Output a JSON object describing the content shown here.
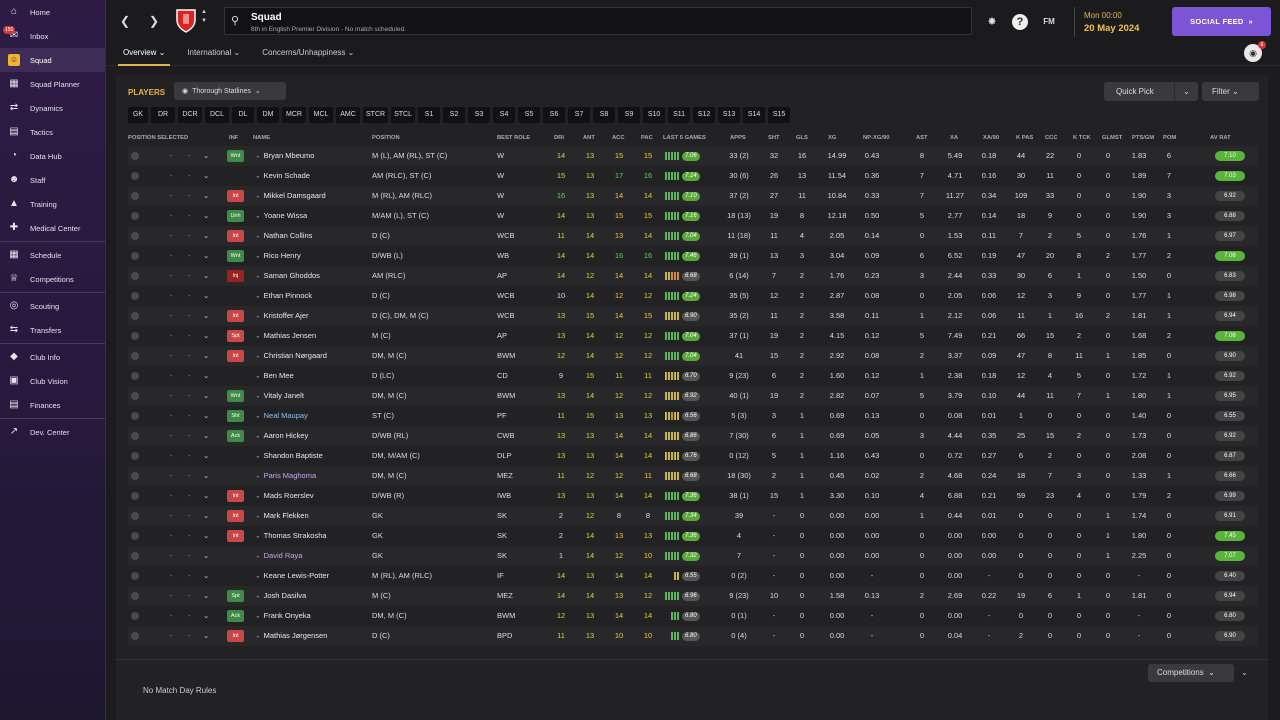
{
  "nav": [
    {
      "label": "Home",
      "icon": "home-icon",
      "glyph": "⌂"
    },
    {
      "label": "Inbox",
      "icon": "inbox-icon",
      "glyph": "✉",
      "badge": "150"
    },
    {
      "label": "Squad",
      "icon": "squad-icon",
      "glyph": "☺",
      "selected": true
    },
    {
      "label": "Squad Planner",
      "icon": "squad-planner-icon",
      "glyph": "▦"
    },
    {
      "label": "Dynamics",
      "icon": "dynamics-icon",
      "glyph": "⇄"
    },
    {
      "label": "Tactics",
      "icon": "tactics-icon",
      "glyph": "▤"
    },
    {
      "label": "Data Hub",
      "icon": "data-hub-icon",
      "glyph": "◔"
    },
    {
      "label": "Staff",
      "icon": "staff-icon",
      "glyph": "☻"
    },
    {
      "label": "Training",
      "icon": "training-icon",
      "glyph": "▲"
    },
    {
      "label": "Medical Center",
      "icon": "medical-center-icon",
      "glyph": "✚"
    },
    {
      "label": "Schedule",
      "icon": "schedule-icon",
      "glyph": "▦",
      "sep": true
    },
    {
      "label": "Competitions",
      "icon": "competitions-icon",
      "glyph": "♕"
    },
    {
      "label": "Scouting",
      "icon": "scouting-icon",
      "glyph": "◎",
      "sep": true
    },
    {
      "label": "Transfers",
      "icon": "transfers-icon",
      "glyph": "⇆"
    },
    {
      "label": "Club Info",
      "icon": "club-info-icon",
      "glyph": "◆",
      "sep": true
    },
    {
      "label": "Club Vision",
      "icon": "club-vision-icon",
      "glyph": "▣"
    },
    {
      "label": "Finances",
      "icon": "finances-icon",
      "glyph": "▤"
    },
    {
      "label": "Dev. Center",
      "icon": "dev-center-icon",
      "glyph": "↗",
      "sep": true
    }
  ],
  "header": {
    "title": "Squad",
    "subtitle": "8th in English Premier Division - No match scheduled.",
    "fm": "FM",
    "day": "Mon 00:00",
    "date": "20 May 2024",
    "social": "SOCIAL FEED",
    "avatar_badge": "6"
  },
  "subtabs": [
    "Overview",
    "International",
    "Concerns/Unhappiness"
  ],
  "toolbar": {
    "players": "PLAYERS",
    "view": "Thorough Statlines",
    "quick_pick": "Quick Pick",
    "filter": "Filter"
  },
  "positions": [
    "GK",
    "DR",
    "DCR",
    "DCL",
    "DL",
    "DM",
    "MCR",
    "MCL",
    "AMC",
    "STCR",
    "STCL",
    "S1",
    "S2",
    "S3",
    "S4",
    "S5",
    "S6",
    "S7",
    "S8",
    "S9",
    "S10",
    "S11",
    "S12",
    "S13",
    "S14",
    "S15"
  ],
  "columns": [
    "POSITION SELECTED",
    "INF",
    "NAME",
    "POSITION",
    "BEST ROLE",
    "DRI",
    "ANT",
    "ACC",
    "PAC",
    "LAST 5 GAMES",
    "APPS",
    "SHT",
    "GLS",
    "XG",
    "NP-XG/90",
    "AST",
    "XA",
    "XA/90",
    "K PAS",
    "CCC",
    "K TCK",
    "GLMST",
    "PTS/GM",
    "POM",
    "AV RAT"
  ],
  "players": [
    {
      "inf": "Wnt",
      "infc": "green",
      "name": "Bryan Mbeumo",
      "pos": "M (L), AM (RL), ST (C)",
      "role": "W",
      "dri": "14",
      "ant": "13",
      "acc": "15",
      "pac": "15",
      "form": "ggggg",
      "fr": "7.06",
      "frh": true,
      "apps": "33 (2)",
      "sht": "32",
      "gls": "16",
      "xg": "14.99",
      "npxg": "0.43",
      "ast": "8",
      "xa": "5.49",
      "xa90": "0.18",
      "kpas": "44",
      "ccc": "22",
      "ktck": "0",
      "glmst": "0",
      "ptsgm": "1.83",
      "pom": "6",
      "avrat": "7.10",
      "avh": true,
      "c": [
        "y",
        "y",
        "y",
        "y"
      ]
    },
    {
      "inf": "",
      "infc": "",
      "name": "Kevin Schade",
      "pos": "AM (RLC), ST (C)",
      "role": "W",
      "dri": "15",
      "ant": "13",
      "acc": "17",
      "pac": "16",
      "form": "ggggg",
      "fr": "7.14",
      "frh": true,
      "apps": "30 (6)",
      "sht": "26",
      "gls": "13",
      "xg": "11.54",
      "npxg": "0.36",
      "ast": "7",
      "xa": "4.71",
      "xa90": "0.16",
      "kpas": "30",
      "ccc": "11",
      "ktck": "0",
      "glmst": "0",
      "ptsgm": "1.89",
      "pom": "7",
      "avrat": "7.03",
      "avh": true,
      "c": [
        "y",
        "y",
        "g",
        "g"
      ]
    },
    {
      "inf": "Int",
      "infc": "red",
      "name": "Mikkel Damsgaard",
      "pos": "M (RL), AM (RLC)",
      "role": "W",
      "dri": "16",
      "ant": "13",
      "acc": "14",
      "pac": "14",
      "form": "ggggg",
      "fr": "7.10",
      "frh": true,
      "apps": "37 (2)",
      "sht": "27",
      "gls": "11",
      "xg": "10.84",
      "npxg": "0.33",
      "ast": "7",
      "xa": "11.27",
      "xa90": "0.34",
      "kpas": "109",
      "ccc": "33",
      "ktck": "0",
      "glmst": "0",
      "ptsgm": "1.90",
      "pom": "3",
      "avrat": "6.92",
      "avh": false,
      "c": [
        "g",
        "y",
        "y",
        "y"
      ]
    },
    {
      "inf": "Unh",
      "infc": "green",
      "name": "Yoane Wissa",
      "pos": "M/AM (L), ST (C)",
      "role": "W",
      "dri": "14",
      "ant": "13",
      "acc": "15",
      "pac": "15",
      "form": "ggggg",
      "fr": "7.16",
      "frh": true,
      "apps": "18 (13)",
      "sht": "19",
      "gls": "8",
      "xg": "12.18",
      "npxg": "0.50",
      "ast": "5",
      "xa": "2.77",
      "xa90": "0.14",
      "kpas": "18",
      "ccc": "9",
      "ktck": "0",
      "glmst": "0",
      "ptsgm": "1.90",
      "pom": "3",
      "avrat": "6.88",
      "avh": false,
      "c": [
        "y",
        "y",
        "y",
        "y"
      ]
    },
    {
      "inf": "Int",
      "infc": "red",
      "name": "Nathan Collins",
      "pos": "D (C)",
      "role": "WCB",
      "dri": "11",
      "ant": "14",
      "acc": "13",
      "pac": "14",
      "form": "ggggg",
      "fr": "7.04",
      "frh": true,
      "apps": "11 (18)",
      "sht": "11",
      "gls": "4",
      "xg": "2.05",
      "npxg": "0.14",
      "ast": "0",
      "xa": "1.53",
      "xa90": "0.11",
      "kpas": "7",
      "ccc": "2",
      "ktck": "5",
      "glmst": "0",
      "ptsgm": "1.76",
      "pom": "1",
      "avrat": "6.97",
      "avh": false,
      "c": [
        "y",
        "y",
        "y",
        "y"
      ]
    },
    {
      "inf": "Wnt",
      "infc": "green",
      "name": "Rico Henry",
      "pos": "D/WB (L)",
      "role": "WB",
      "dri": "14",
      "ant": "14",
      "acc": "16",
      "pac": "16",
      "form": "ggggg",
      "fr": "7.46",
      "frh": true,
      "apps": "39 (1)",
      "sht": "13",
      "gls": "3",
      "xg": "3.04",
      "npxg": "0.09",
      "ast": "6",
      "xa": "6.52",
      "xa90": "0.19",
      "kpas": "47",
      "ccc": "20",
      "ktck": "8",
      "glmst": "2",
      "ptsgm": "1.77",
      "pom": "2",
      "avrat": "7.08",
      "avh": true,
      "c": [
        "y",
        "y",
        "g",
        "g"
      ]
    },
    {
      "inf": "Inj",
      "infc": "dred",
      "name": "Saman Ghoddos",
      "pos": "AM (RLC)",
      "role": "AP",
      "dri": "14",
      "ant": "12",
      "acc": "14",
      "pac": "14",
      "form": "yyooo",
      "fr": "6.68",
      "frh": false,
      "apps": "6 (14)",
      "sht": "7",
      "gls": "2",
      "xg": "1.76",
      "npxg": "0.23",
      "ast": "3",
      "xa": "2.44",
      "xa90": "0.33",
      "kpas": "30",
      "ccc": "6",
      "ktck": "1",
      "glmst": "0",
      "ptsgm": "1.50",
      "pom": "0",
      "avrat": "6.83",
      "avh": false,
      "c": [
        "y",
        "y",
        "y",
        "y"
      ]
    },
    {
      "inf": "",
      "infc": "",
      "name": "Ethan Pinnock",
      "pos": "D (C)",
      "role": "WCB",
      "dri": "10",
      "ant": "14",
      "acc": "12",
      "pac": "12",
      "form": "ggggg",
      "fr": "7.24",
      "frh": true,
      "apps": "35 (5)",
      "sht": "12",
      "gls": "2",
      "xg": "2.87",
      "npxg": "0.08",
      "ast": "0",
      "xa": "2.05",
      "xa90": "0.06",
      "kpas": "12",
      "ccc": "3",
      "ktck": "9",
      "glmst": "0",
      "ptsgm": "1.77",
      "pom": "1",
      "avrat": "6.98",
      "avh": false,
      "c": [
        "w",
        "y",
        "y",
        "y"
      ]
    },
    {
      "inf": "Int",
      "infc": "red",
      "name": "Kristoffer Ajer",
      "pos": "D (C), DM, M (C)",
      "role": "WCB",
      "dri": "13",
      "ant": "15",
      "acc": "14",
      "pac": "15",
      "form": "yyyyy",
      "fr": "6.90",
      "frh": false,
      "apps": "35 (2)",
      "sht": "11",
      "gls": "2",
      "xg": "3.58",
      "npxg": "0.11",
      "ast": "1",
      "xa": "2.12",
      "xa90": "0.06",
      "kpas": "11",
      "ccc": "1",
      "ktck": "16",
      "glmst": "2",
      "ptsgm": "1.81",
      "pom": "1",
      "avrat": "6.94",
      "avh": false,
      "c": [
        "y",
        "y",
        "y",
        "y"
      ]
    },
    {
      "inf": "Spt",
      "infc": "red",
      "name": "Mathias Jensen",
      "pos": "M (C)",
      "role": "AP",
      "dri": "13",
      "ant": "14",
      "acc": "12",
      "pac": "12",
      "form": "ggggg",
      "fr": "7.04",
      "frh": true,
      "apps": "37 (1)",
      "sht": "19",
      "gls": "2",
      "xg": "4.15",
      "npxg": "0.12",
      "ast": "5",
      "xa": "7.49",
      "xa90": "0.21",
      "kpas": "66",
      "ccc": "15",
      "ktck": "2",
      "glmst": "0",
      "ptsgm": "1.68",
      "pom": "2",
      "avrat": "7.08",
      "avh": true,
      "c": [
        "y",
        "y",
        "y",
        "y"
      ]
    },
    {
      "inf": "Int",
      "infc": "red",
      "name": "Christian Nørgaard",
      "pos": "DM, M (C)",
      "role": "BWM",
      "dri": "12",
      "ant": "14",
      "acc": "12",
      "pac": "12",
      "form": "ggggg",
      "fr": "7.04",
      "frh": true,
      "apps": "41",
      "sht": "15",
      "gls": "2",
      "xg": "2.92",
      "npxg": "0.08",
      "ast": "2",
      "xa": "3.37",
      "xa90": "0.09",
      "kpas": "47",
      "ccc": "8",
      "ktck": "11",
      "glmst": "1",
      "ptsgm": "1.85",
      "pom": "0",
      "avrat": "6.90",
      "avh": false,
      "c": [
        "y",
        "y",
        "y",
        "y"
      ]
    },
    {
      "inf": "",
      "infc": "",
      "name": "Ben Mee",
      "pos": "D (LC)",
      "role": "CD",
      "dri": "9",
      "ant": "15",
      "acc": "11",
      "pac": "11",
      "form": "yyyyy",
      "fr": "6.70",
      "frh": false,
      "apps": "9 (23)",
      "sht": "6",
      "gls": "2",
      "xg": "1.60",
      "npxg": "0.12",
      "ast": "1",
      "xa": "2.38",
      "xa90": "0.18",
      "kpas": "12",
      "ccc": "4",
      "ktck": "5",
      "glmst": "0",
      "ptsgm": "1.72",
      "pom": "1",
      "avrat": "6.92",
      "avh": false,
      "c": [
        "w",
        "y",
        "y",
        "y"
      ]
    },
    {
      "inf": "Wnt",
      "infc": "green",
      "name": "Vitaly Janelt",
      "pos": "DM, M (C)",
      "role": "BWM",
      "dri": "13",
      "ant": "14",
      "acc": "12",
      "pac": "12",
      "form": "yyyyy",
      "fr": "6.92",
      "frh": false,
      "apps": "40 (1)",
      "sht": "19",
      "gls": "2",
      "xg": "2.82",
      "npxg": "0.07",
      "ast": "5",
      "xa": "3.79",
      "xa90": "0.10",
      "kpas": "44",
      "ccc": "11",
      "ktck": "7",
      "glmst": "1",
      "ptsgm": "1.80",
      "pom": "1",
      "avrat": "6.95",
      "avh": false,
      "c": [
        "y",
        "y",
        "y",
        "y"
      ]
    },
    {
      "inf": "Sht",
      "infc": "green",
      "name": "Neal Maupay",
      "pos": "ST (C)",
      "role": "PF",
      "dri": "11",
      "ant": "15",
      "acc": "13",
      "pac": "13",
      "form": "yyoyy",
      "fr": "6.56",
      "frh": false,
      "apps": "5 (3)",
      "sht": "3",
      "gls": "1",
      "xg": "0.69",
      "npxg": "0.13",
      "ast": "0",
      "xa": "0.08",
      "xa90": "0.01",
      "kpas": "1",
      "ccc": "0",
      "ktck": "0",
      "glmst": "0",
      "ptsgm": "1.40",
      "pom": "0",
      "avrat": "6.55",
      "avh": false,
      "blue": true,
      "c": [
        "y",
        "y",
        "y",
        "y"
      ]
    },
    {
      "inf": "Ack",
      "infc": "green",
      "name": "Aaron Hickey",
      "pos": "D/WB (RL)",
      "role": "CWB",
      "dri": "13",
      "ant": "13",
      "acc": "14",
      "pac": "14",
      "form": "yyyyy",
      "fr": "6.86",
      "frh": false,
      "apps": "7 (30)",
      "sht": "6",
      "gls": "1",
      "xg": "0.69",
      "npxg": "0.05",
      "ast": "3",
      "xa": "4.44",
      "xa90": "0.35",
      "kpas": "25",
      "ccc": "15",
      "ktck": "2",
      "glmst": "0",
      "ptsgm": "1.73",
      "pom": "0",
      "avrat": "6.92",
      "avh": false,
      "c": [
        "y",
        "y",
        "y",
        "y"
      ]
    },
    {
      "inf": "",
      "infc": "",
      "name": "Shandon Baptiste",
      "pos": "DM, M/AM (C)",
      "role": "DLP",
      "dri": "13",
      "ant": "13",
      "acc": "14",
      "pac": "14",
      "form": "yyyyy",
      "fr": "6.76",
      "frh": false,
      "apps": "0 (12)",
      "sht": "5",
      "gls": "1",
      "xg": "1.16",
      "npxg": "0.43",
      "ast": "0",
      "xa": "0.72",
      "xa90": "0.27",
      "kpas": "6",
      "ccc": "2",
      "ktck": "0",
      "glmst": "0",
      "ptsgm": "2.08",
      "pom": "0",
      "avrat": "6.87",
      "avh": false,
      "c": [
        "y",
        "y",
        "y",
        "y"
      ]
    },
    {
      "inf": "",
      "infc": "",
      "name": "Paris Maghoma",
      "pos": "DM, M (C)",
      "role": "MEZ",
      "dri": "11",
      "ant": "12",
      "acc": "12",
      "pac": "11",
      "form": "yyyyy",
      "fr": "6.68",
      "frh": false,
      "apps": "18 (30)",
      "sht": "2",
      "gls": "1",
      "xg": "0.45",
      "npxg": "0.02",
      "ast": "2",
      "xa": "4.68",
      "xa90": "0.24",
      "kpas": "18",
      "ccc": "7",
      "ktck": "3",
      "glmst": "0",
      "ptsgm": "1.33",
      "pom": "1",
      "avrat": "6.66",
      "avh": false,
      "loan": true,
      "c": [
        "y",
        "y",
        "y",
        "y"
      ]
    },
    {
      "inf": "Int",
      "infc": "red",
      "name": "Mads Roerslev",
      "pos": "D/WB (R)",
      "role": "IWB",
      "dri": "13",
      "ant": "13",
      "acc": "14",
      "pac": "14",
      "form": "ggggg",
      "fr": "7.36",
      "frh": true,
      "apps": "38 (1)",
      "sht": "15",
      "gls": "1",
      "xg": "3.30",
      "npxg": "0.10",
      "ast": "4",
      "xa": "6.88",
      "xa90": "0.21",
      "kpas": "59",
      "ccc": "23",
      "ktck": "4",
      "glmst": "0",
      "ptsgm": "1.79",
      "pom": "2",
      "avrat": "6.99",
      "avh": false,
      "c": [
        "y",
        "y",
        "y",
        "y"
      ]
    },
    {
      "inf": "Int",
      "infc": "red",
      "name": "Mark Flekken",
      "pos": "GK",
      "role": "SK",
      "dri": "2",
      "ant": "12",
      "acc": "8",
      "pac": "8",
      "form": "ggggg",
      "fr": "7.34",
      "frh": true,
      "apps": "39",
      "sht": "-",
      "gls": "0",
      "xg": "0.00",
      "npxg": "0.00",
      "ast": "1",
      "xa": "0.44",
      "xa90": "0.01",
      "kpas": "0",
      "ccc": "0",
      "ktck": "0",
      "glmst": "1",
      "ptsgm": "1.74",
      "pom": "0",
      "avrat": "6.91",
      "avh": false,
      "c": [
        "w",
        "y",
        "w",
        "w"
      ]
    },
    {
      "inf": "Int",
      "infc": "red",
      "name": "Thomas Strakosha",
      "pos": "GK",
      "role": "SK",
      "dri": "2",
      "ant": "14",
      "acc": "13",
      "pac": "13",
      "form": "ggggg",
      "fr": "7.36",
      "frh": true,
      "apps": "4",
      "sht": "-",
      "gls": "0",
      "xg": "0.00",
      "npxg": "0.00",
      "ast": "0",
      "xa": "0.00",
      "xa90": "0.00",
      "kpas": "0",
      "ccc": "0",
      "ktck": "0",
      "glmst": "1",
      "ptsgm": "1.80",
      "pom": "0",
      "avrat": "7.45",
      "avh": true,
      "c": [
        "w",
        "y",
        "y",
        "y"
      ]
    },
    {
      "inf": "",
      "infc": "",
      "name": "David Raya",
      "pos": "GK",
      "role": "SK",
      "dri": "1",
      "ant": "14",
      "acc": "12",
      "pac": "10",
      "form": "ggggg",
      "fr": "7.32",
      "frh": true,
      "apps": "7",
      "sht": "-",
      "gls": "0",
      "xg": "0.00",
      "npxg": "0.00",
      "ast": "0",
      "xa": "0.00",
      "xa90": "0.00",
      "kpas": "0",
      "ccc": "0",
      "ktck": "0",
      "glmst": "1",
      "ptsgm": "2.25",
      "pom": "0",
      "avrat": "7.07",
      "avh": true,
      "loan": true,
      "c": [
        "w",
        "y",
        "y",
        "y"
      ]
    },
    {
      "inf": "",
      "infc": "",
      "name": "Keane Lewis-Potter",
      "pos": "M (RL), AM (RLC)",
      "role": "IF",
      "dri": "14",
      "ant": "13",
      "acc": "14",
      "pac": "14",
      "form": "yy",
      "fr": "6.55",
      "frh": false,
      "apps": "0 (2)",
      "sht": "-",
      "gls": "0",
      "xg": "0.00",
      "npxg": "-",
      "ast": "0",
      "xa": "0.00",
      "xa90": "-",
      "kpas": "0",
      "ccc": "0",
      "ktck": "0",
      "glmst": "0",
      "ptsgm": "-",
      "pom": "0",
      "avrat": "6.40",
      "avh": false,
      "c": [
        "y",
        "y",
        "y",
        "y"
      ]
    },
    {
      "inf": "Spt",
      "infc": "green",
      "name": "Josh Dasilva",
      "pos": "M (C)",
      "role": "MEZ",
      "dri": "14",
      "ant": "14",
      "acc": "13",
      "pac": "12",
      "form": "ggggg",
      "fr": "6.96",
      "frh": false,
      "apps": "9 (23)",
      "sht": "10",
      "gls": "0",
      "xg": "1.58",
      "npxg": "0.13",
      "ast": "2",
      "xa": "2.69",
      "xa90": "0.22",
      "kpas": "19",
      "ccc": "6",
      "ktck": "1",
      "glmst": "0",
      "ptsgm": "1.81",
      "pom": "0",
      "avrat": "6.94",
      "avh": false,
      "c": [
        "y",
        "y",
        "y",
        "y"
      ]
    },
    {
      "inf": "Ack",
      "infc": "green",
      "name": "Frank Onyeka",
      "pos": "DM, M (C)",
      "role": "BWM",
      "dri": "12",
      "ant": "13",
      "acc": "14",
      "pac": "14",
      "form": "ggg",
      "fr": "6.80",
      "frh": false,
      "apps": "0 (1)",
      "sht": "-",
      "gls": "0",
      "xg": "0.00",
      "npxg": "-",
      "ast": "0",
      "xa": "0.00",
      "xa90": "-",
      "kpas": "0",
      "ccc": "0",
      "ktck": "0",
      "glmst": "0",
      "ptsgm": "-",
      "pom": "0",
      "avrat": "6.80",
      "avh": false,
      "c": [
        "y",
        "y",
        "y",
        "y"
      ]
    },
    {
      "inf": "Int",
      "infc": "red",
      "name": "Mathias Jørgensen",
      "pos": "D (C)",
      "role": "BPD",
      "dri": "11",
      "ant": "13",
      "acc": "10",
      "pac": "10",
      "form": "ggg",
      "fr": "6.80",
      "frh": false,
      "apps": "0 (4)",
      "sht": "-",
      "gls": "0",
      "xg": "0.00",
      "npxg": "-",
      "ast": "0",
      "xa": "0.04",
      "xa90": "-",
      "kpas": "2",
      "ccc": "0",
      "ktck": "0",
      "glmst": "0",
      "ptsgm": "-",
      "pom": "0",
      "avrat": "6.90",
      "avh": false,
      "c": [
        "y",
        "y",
        "y",
        "y"
      ]
    }
  ],
  "footer": {
    "rules": "No Match Day Rules",
    "competitions": "Competitions"
  }
}
